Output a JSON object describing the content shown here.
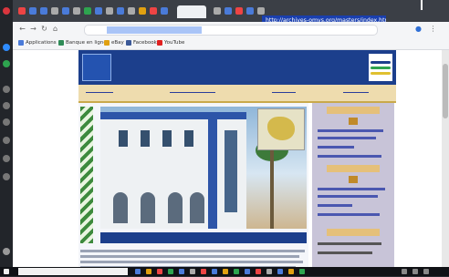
{
  "browser": {
    "hover_url": "http://archives-omvs.org/masters/index.htm",
    "address_text": "",
    "bookmarks": [
      {
        "label": "Applications",
        "color": "#4a7bd9"
      },
      {
        "label": "Banque en ligne",
        "color": "#2e8b57"
      },
      {
        "label": "eBay",
        "color": "#e0a010"
      },
      {
        "label": "Facebook",
        "color": "#3b5998"
      },
      {
        "label": "YouTube",
        "color": "#e02020"
      }
    ]
  },
  "site": {
    "logo_text": "",
    "title": "",
    "subtitle": "",
    "nav": [
      {
        "label": "",
        "pos": "left"
      },
      {
        "label": "",
        "pos": "mid1"
      },
      {
        "label": "",
        "pos": "mid2"
      },
      {
        "label": "",
        "pos": "right"
      }
    ],
    "hero_caption": "",
    "sidebar": {
      "heading_1": "",
      "heading_2": "",
      "heading_3": "",
      "links": [
        "",
        "",
        "",
        "",
        "",
        "",
        "",
        "",
        "",
        ""
      ]
    }
  },
  "taskbar": {
    "search_placeholder": ""
  },
  "colors": {
    "header_blue": "#1c3f8c",
    "nav_tan": "#eedcae",
    "sidebar_lavender": "#c8c4d8",
    "link_blue": "#2a3d9a",
    "tooltip_blue": "#1a3fae"
  }
}
